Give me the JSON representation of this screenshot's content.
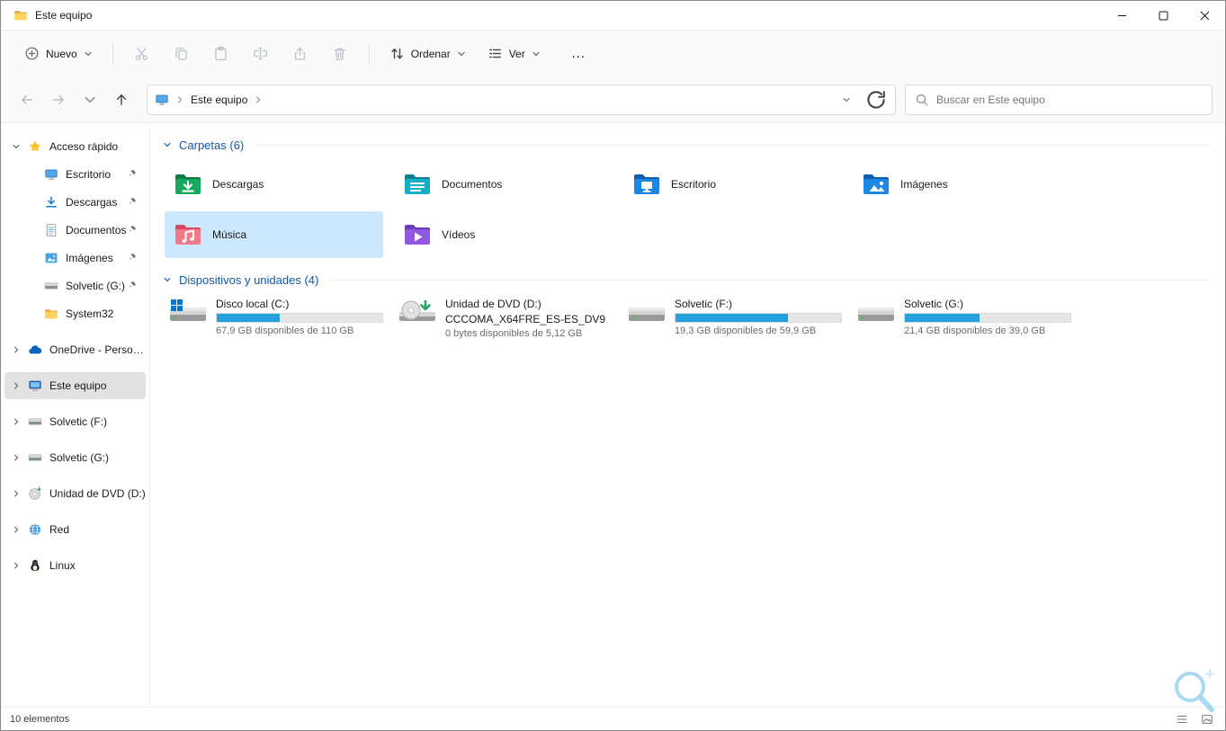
{
  "colors": {
    "accent": "#005fb8",
    "section_header_blue": "#1158a8",
    "tile_selection_fill": "#cce8ff",
    "progress_fill": "#26a0da"
  },
  "window": {
    "title": "Este equipo",
    "title_icon": "folder-icon"
  },
  "toolbar": {
    "new_label": "Nuevo",
    "sort_label": "Ordenar",
    "view_label": "Ver",
    "more_label": "…",
    "disabled_icons": [
      "cut-icon",
      "copy-icon",
      "paste-icon",
      "rename-icon",
      "share-icon",
      "delete-icon"
    ]
  },
  "navbar": {
    "breadcrumb_root": "Este equipo",
    "search_placeholder": "Buscar en Este equipo"
  },
  "sidebar": {
    "items": [
      {
        "label": "Acceso rápido",
        "icon": "star-icon",
        "expanded": true
      },
      {
        "label": "Escritorio",
        "icon": "desktop-icon",
        "pinned": true
      },
      {
        "label": "Descargas",
        "icon": "download-icon",
        "pinned": true
      },
      {
        "label": "Documentos",
        "icon": "document-icon",
        "pinned": true
      },
      {
        "label": "Imágenes",
        "icon": "picture-icon",
        "pinned": true
      },
      {
        "label": "Solvetic (G:)",
        "icon": "drive-icon",
        "pinned": true
      },
      {
        "label": "System32",
        "icon": "folder-icon"
      },
      {
        "label": "OneDrive - Personal",
        "icon": "onedrive-icon"
      },
      {
        "label": "Este equipo",
        "icon": "computer-icon",
        "selected": true
      },
      {
        "label": "Solvetic (F:)",
        "icon": "drive-icon"
      },
      {
        "label": "Solvetic (G:)",
        "icon": "drive-icon"
      },
      {
        "label": "Unidad de DVD (D:)",
        "icon": "dvd-icon"
      },
      {
        "label": "Red",
        "icon": "network-icon"
      },
      {
        "label": "Linux",
        "icon": "linux-icon"
      }
    ]
  },
  "main": {
    "folders_header": "Carpetas (6)",
    "devices_header": "Dispositivos y unidades (4)",
    "folders": [
      {
        "label": "Descargas",
        "icon": "downloads-folder-icon"
      },
      {
        "label": "Documentos",
        "icon": "documents-folder-icon"
      },
      {
        "label": "Escritorio",
        "icon": "desktop-folder-icon"
      },
      {
        "label": "Imágenes",
        "icon": "pictures-folder-icon"
      },
      {
        "label": "Música",
        "icon": "music-folder-icon",
        "selected": true
      },
      {
        "label": "Vídeos",
        "icon": "videos-folder-icon"
      }
    ],
    "devices": [
      {
        "name": "Disco local (C:)",
        "icon": "local-disk-icon",
        "free_text": "67,9 GB disponibles de 110 GB",
        "used_percent": 38
      },
      {
        "name": "Unidad de DVD (D:)",
        "icon": "dvd-drive-icon",
        "subtitle": "CCCOMA_X64FRE_ES-ES_DV9",
        "free_text": "0 bytes disponibles de 5,12 GB"
      },
      {
        "name": "Solvetic (F:)",
        "icon": "hard-drive-icon",
        "free_text": "19,3 GB disponibles de 59,9 GB",
        "used_percent": 68
      },
      {
        "name": "Solvetic (G:)",
        "icon": "hard-drive-icon",
        "free_text": "21,4 GB disponibles de 39,0 GB",
        "used_percent": 45
      }
    ]
  },
  "statusbar": {
    "items_count": "10 elementos"
  }
}
